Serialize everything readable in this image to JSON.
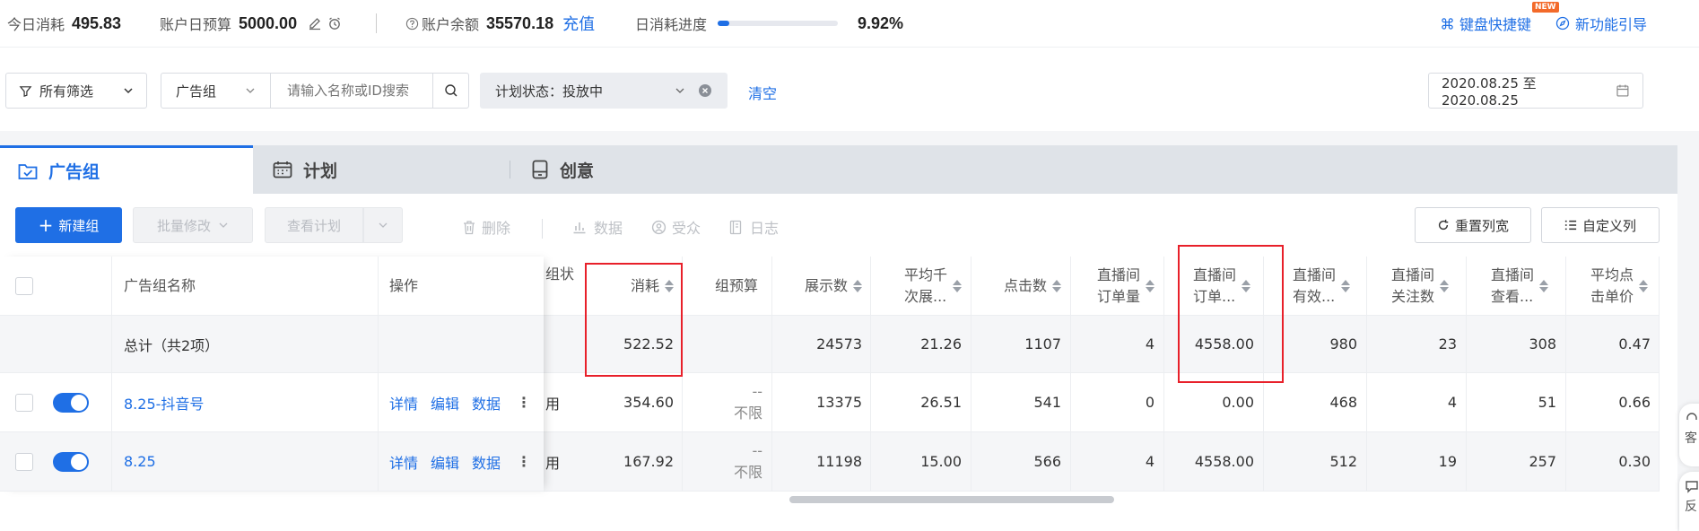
{
  "topbar": {
    "today_spend_label": "今日消耗",
    "today_spend": "495.83",
    "daily_budget_label": "账户日预算",
    "daily_budget": "5000.00",
    "balance_label": "账户余额",
    "balance": "35570.18",
    "recharge": "充值",
    "progress_label": "日消耗进度",
    "progress_fraction": 0.0992,
    "progress_pct": "9.92%",
    "shortcut": "键盘快捷键",
    "guide": "新功能引导",
    "new_badge": "NEW"
  },
  "filters": {
    "all_filters": "所有筛选",
    "group_select": "广告组",
    "search_placeholder": "请输入名称或ID搜索",
    "status_label": "计划状态：",
    "status_value": "投放中",
    "clear": "清空",
    "date_range": "2020.08.25 至 2020.08.25"
  },
  "tabs": [
    {
      "label": "广告组",
      "icon": "folder-check-icon"
    },
    {
      "label": "计划",
      "icon": "calendar-icon"
    },
    {
      "label": "创意",
      "icon": "tablet-icon"
    }
  ],
  "toolbar": {
    "new_group": "新建组",
    "batch_edit": "批量修改",
    "view_plan": "查看计划",
    "delete": "删除",
    "data": "数据",
    "audience": "受众",
    "log": "日志",
    "reset_width": "重置列宽",
    "custom_cols": "自定义列"
  },
  "table": {
    "headers": {
      "name": "广告组名称",
      "ops": "操作",
      "status": "组状",
      "spend": "消耗",
      "budget": "组预算",
      "impressions": "展示数",
      "cpm_1": "平均千",
      "cpm_2": "次展...",
      "clicks": "点击数",
      "live_orders_1": "直播间",
      "live_orders_2": "订单量",
      "live_amount_1": "直播间",
      "live_amount_2": "订单...",
      "live_valid_1": "直播间",
      "live_valid_2": "有效...",
      "live_follow_1": "直播间",
      "live_follow_2": "关注数",
      "live_view_1": "直播间",
      "live_view_2": "查看...",
      "cpc_1": "平均点",
      "cpc_2": "击单价"
    },
    "total": {
      "label": "总计（共2项）",
      "spend": "522.52",
      "impressions": "24573",
      "cpm": "21.26",
      "clicks": "1107",
      "live_orders": "4",
      "live_amount": "4558.00",
      "live_valid": "980",
      "live_follow": "23",
      "live_view": "308",
      "cpc": "0.47"
    },
    "rows": [
      {
        "name": "8.25-抖音号",
        "op_detail": "详情",
        "op_edit": "编辑",
        "op_data": "数据",
        "status": "用",
        "spend": "354.60",
        "budget_dash": "--",
        "budget": "不限",
        "impressions": "13375",
        "cpm": "26.51",
        "clicks": "541",
        "live_orders": "0",
        "live_amount": "0.00",
        "live_valid": "468",
        "live_follow": "4",
        "live_view": "51",
        "cpc": "0.66"
      },
      {
        "name": "8.25",
        "op_detail": "详情",
        "op_edit": "编辑",
        "op_data": "数据",
        "status": "用",
        "spend": "167.92",
        "budget_dash": "--",
        "budget": "不限",
        "impressions": "11198",
        "cpm": "15.00",
        "clicks": "566",
        "live_orders": "4",
        "live_amount": "4558.00",
        "live_valid": "512",
        "live_follow": "19",
        "live_view": "257",
        "cpc": "0.30"
      }
    ]
  },
  "side": {
    "service": "客",
    "feedback": "反"
  },
  "colors": {
    "primary": "#1f6fe5",
    "highlight_box": "#e8202a"
  }
}
